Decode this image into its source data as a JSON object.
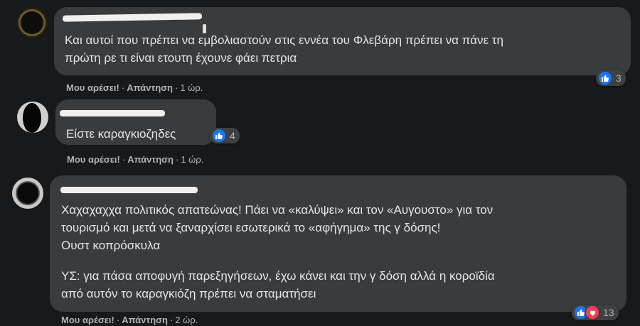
{
  "comments": [
    {
      "text": "Και αυτοί που πρέπει να εμβολιαστούν στις εννέα του Φλεβάρη πρέπει να πάνε τη\nπρώτη ρε τι είναι ετουτη έχουνε φάει πετρια",
      "like_label": "Μου αρέσει!",
      "reply_label": "Απάντηση",
      "time": "1 ώρ.",
      "reaction_count": "3",
      "reactions": [
        "like-icon"
      ]
    },
    {
      "text": "Είστε καραγκιοζηδες",
      "like_label": "Μου αρέσει!",
      "reply_label": "Απάντηση",
      "time": "1 ώρ.",
      "reaction_count": "4",
      "reactions": [
        "like-icon"
      ]
    },
    {
      "text": "Χαχαχαχχα πολιτικός απατεώνας! Πάει να «καλύψει» και τον «Αυγουστο» για τον\nτουρισμό και μετά να ξαναρχίσει εσωτερικά το «αφήγημα» της γ δόσης!\nΟυστ κοπρόσκυλα",
      "text2": "ΥΣ: για πάσα αποφυγή παρεξηγήσεων, έχω κάνει και την γ δόση αλλά η κοροϊδία\nαπό αυτόν το καραγκιόζη πρέπει να σταματήσει",
      "like_label": "Μου αρέσει!",
      "reply_label": "Απάντηση",
      "time": "2 ώρ.",
      "reaction_count": "13",
      "reactions": [
        "like-icon",
        "heart-icon"
      ]
    }
  ],
  "separator": "·",
  "colors": {
    "background": "#18191a",
    "bubble": "#3a3b3c",
    "like": "#1877f2",
    "heart": "#f33e58"
  }
}
